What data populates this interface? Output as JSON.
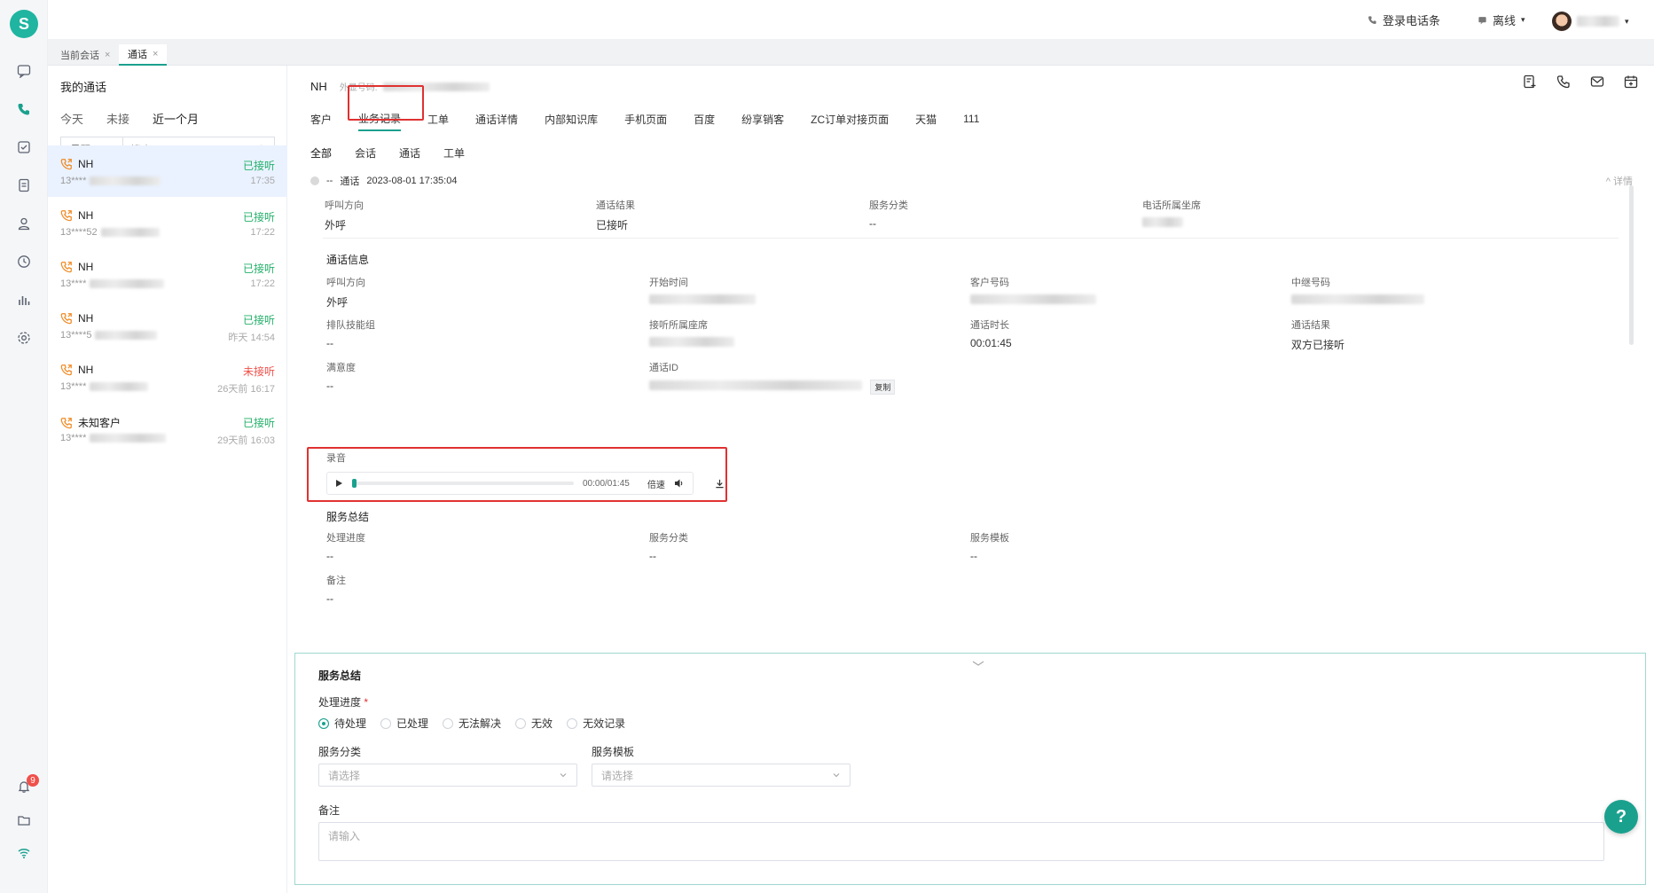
{
  "app": {
    "logo": "S"
  },
  "topbar": {
    "phonebar_label": "登录电话条",
    "status_label": "离线",
    "status_caret": "▾",
    "user_caret": "▾"
  },
  "session_tabs": [
    {
      "label": "当前会话",
      "close": "×"
    },
    {
      "label": "通话",
      "close": "×"
    }
  ],
  "rail": {
    "notification_count": "9"
  },
  "conv_list": {
    "title": "我的通话",
    "filters": [
      "今天",
      "未接",
      "近一个月"
    ],
    "select_label": "号码",
    "search_placeholder": "搜索",
    "items": [
      {
        "name": "NH",
        "status": "已接听",
        "phone": "13****",
        "time": "17:35"
      },
      {
        "name": "NH",
        "status": "已接听",
        "phone": "13****52",
        "time": "17:22"
      },
      {
        "name": "NH",
        "status": "已接听",
        "phone": "13****",
        "time": "17:22"
      },
      {
        "name": "NH",
        "status": "已接听",
        "phone": "13****5",
        "time": "昨天 14:54"
      },
      {
        "name": "NH",
        "status": "未接听",
        "phone": "13****",
        "time": "26天前 16:17"
      },
      {
        "name": "未知客户",
        "status": "已接听",
        "phone": "13****",
        "time": "29天前 16:03"
      }
    ]
  },
  "main": {
    "customer_name": "NH",
    "outbound_label": "外显号码:",
    "tabs": [
      "客户",
      "业务记录",
      "工单",
      "通话详情",
      "内部知识库",
      "手机页面",
      "百度",
      "纷享销客",
      "ZC订单对接页面",
      "天猫",
      "111"
    ],
    "subfilters": [
      "全部",
      "会话",
      "通话",
      "工单"
    ],
    "record": {
      "prefix": "--",
      "type": "通话",
      "datetime": "2023-08-01 17:35:04",
      "detail_link": "^ 详情"
    },
    "summary_fields": [
      {
        "label": "呼叫方向",
        "value": "外呼"
      },
      {
        "label": "通话结果",
        "value": "已接听"
      },
      {
        "label": "服务分类",
        "value": "--"
      },
      {
        "label": "电话所属坐席",
        "value": ""
      }
    ],
    "call_info_title": "通话信息",
    "call_info": {
      "direction_label": "呼叫方向",
      "direction_value": "外呼",
      "start_label": "开始时间",
      "customer_no_label": "客户号码",
      "trunk_label": "中继号码",
      "queue_label": "排队技能组",
      "queue_value": "--",
      "agent_label": "接听所属座席",
      "duration_label": "通话时长",
      "duration_value": "00:01:45",
      "result_label": "通话结果",
      "result_value": "双方已接听",
      "satisfaction_label": "满意度",
      "satisfaction_value": "--",
      "call_id_label": "通话ID",
      "copy_label": "复制"
    },
    "recording": {
      "label": "录音",
      "time": "00:00/01:45",
      "speed_label": "倍速",
      "progress": 0
    },
    "service_summary_title": "服务总结",
    "service_summary": {
      "progress_label": "处理进度",
      "progress_value": "--",
      "category_label": "服务分类",
      "category_value": "--",
      "template_label": "服务模板",
      "template_value": "--",
      "remark_label": "备注",
      "remark_value": "--"
    }
  },
  "form": {
    "title": "服务总结",
    "progress_label": "处理进度",
    "required_mark": "*",
    "options": [
      "待处理",
      "已处理",
      "无法解决",
      "无效",
      "无效记录"
    ],
    "selected": "待处理",
    "category_label": "服务分类",
    "category_placeholder": "请选择",
    "template_label": "服务模板",
    "template_placeholder": "请选择",
    "remark_label": "备注",
    "remark_placeholder": "请输入",
    "help_label": "?"
  },
  "colors": {
    "accent": "#1aa18e",
    "answered": "#23b06a",
    "missed": "#f0504a",
    "highlight": "#e03131"
  }
}
